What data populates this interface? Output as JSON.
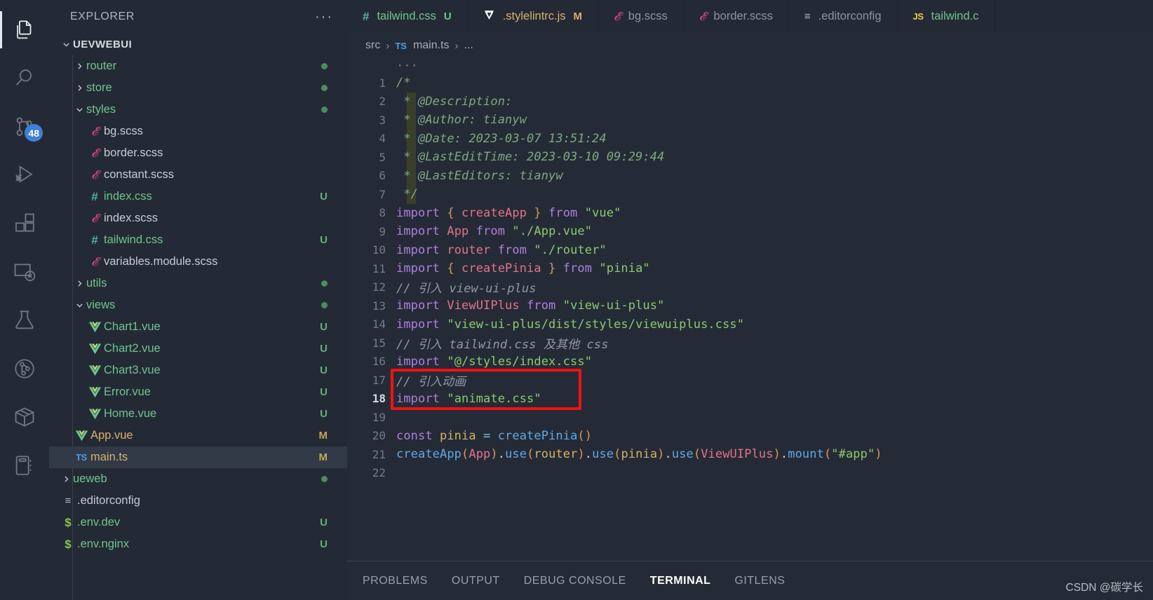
{
  "activity_bar": {
    "items": [
      {
        "name": "explorer",
        "icon": "files-icon",
        "active": true
      },
      {
        "name": "search",
        "icon": "search-icon",
        "active": false
      },
      {
        "name": "source-control",
        "icon": "source-control-icon",
        "active": false,
        "badge": "48"
      },
      {
        "name": "run-and-debug",
        "icon": "run-debug-icon",
        "active": false
      },
      {
        "name": "extensions",
        "icon": "extensions-icon",
        "active": false
      },
      {
        "name": "remote-explorer",
        "icon": "remote-explorer-icon",
        "active": false
      },
      {
        "name": "testing",
        "icon": "flask-icon",
        "active": false
      },
      {
        "name": "gitlens",
        "icon": "gitlens-icon",
        "active": false
      },
      {
        "name": "package",
        "icon": "package-icon",
        "active": false
      },
      {
        "name": "notebook",
        "icon": "notebook-icon",
        "active": false
      }
    ]
  },
  "sidebar": {
    "title": "EXPLORER",
    "more_actions": "···",
    "root_folder": "UEVWEBUI",
    "tree": [
      {
        "label": "router",
        "type": "folder",
        "indent": 1,
        "expanded": false,
        "color": "green",
        "status": "dot",
        "icon": "folder-icon"
      },
      {
        "label": "store",
        "type": "folder",
        "indent": 1,
        "expanded": false,
        "color": "green",
        "status": "dot",
        "icon": "folder-icon"
      },
      {
        "label": "styles",
        "type": "folder",
        "indent": 1,
        "expanded": true,
        "color": "green",
        "status": "dot",
        "icon": "folder-icon"
      },
      {
        "label": "bg.scss",
        "type": "file",
        "indent": 2,
        "color": "gray",
        "status": "",
        "icon": "scss-icon"
      },
      {
        "label": "border.scss",
        "type": "file",
        "indent": 2,
        "color": "gray",
        "status": "",
        "icon": "scss-icon"
      },
      {
        "label": "constant.scss",
        "type": "file",
        "indent": 2,
        "color": "gray",
        "status": "",
        "icon": "scss-icon"
      },
      {
        "label": "index.css",
        "type": "file",
        "indent": 2,
        "color": "green",
        "status": "U",
        "icon": "css-icon"
      },
      {
        "label": "index.scss",
        "type": "file",
        "indent": 2,
        "color": "gray",
        "status": "",
        "icon": "scss-icon"
      },
      {
        "label": "tailwind.css",
        "type": "file",
        "indent": 2,
        "color": "green",
        "status": "U",
        "icon": "css-icon"
      },
      {
        "label": "variables.module.scss",
        "type": "file",
        "indent": 2,
        "color": "gray",
        "status": "",
        "icon": "scss-icon"
      },
      {
        "label": "utils",
        "type": "folder",
        "indent": 1,
        "expanded": false,
        "color": "green",
        "status": "dot",
        "icon": "folder-icon"
      },
      {
        "label": "views",
        "type": "folder",
        "indent": 1,
        "expanded": true,
        "color": "green",
        "status": "dot",
        "icon": "folder-icon"
      },
      {
        "label": "Chart1.vue",
        "type": "file",
        "indent": 2,
        "color": "green",
        "status": "U",
        "icon": "vue-icon"
      },
      {
        "label": "Chart2.vue",
        "type": "file",
        "indent": 2,
        "color": "green",
        "status": "U",
        "icon": "vue-icon"
      },
      {
        "label": "Chart3.vue",
        "type": "file",
        "indent": 2,
        "color": "green",
        "status": "U",
        "icon": "vue-icon"
      },
      {
        "label": "Error.vue",
        "type": "file",
        "indent": 2,
        "color": "green",
        "status": "U",
        "icon": "vue-icon"
      },
      {
        "label": "Home.vue",
        "type": "file",
        "indent": 2,
        "color": "green",
        "status": "U",
        "icon": "vue-icon"
      },
      {
        "label": "App.vue",
        "type": "file",
        "indent": 1,
        "color": "orange",
        "status": "M",
        "icon": "vue-icon"
      },
      {
        "label": "main.ts",
        "type": "file",
        "indent": 1,
        "color": "orange",
        "status": "M",
        "icon": "ts-icon",
        "selected": true
      },
      {
        "label": "ueweb",
        "type": "folder",
        "indent": 0,
        "expanded": false,
        "color": "green",
        "status": "dot",
        "icon": "folder-icon"
      },
      {
        "label": ".editorconfig",
        "type": "file",
        "indent": 0,
        "color": "gray",
        "status": "",
        "icon": "editorconfig-icon"
      },
      {
        "label": ".env.dev",
        "type": "file",
        "indent": 0,
        "color": "green",
        "status": "U",
        "icon": "env-icon"
      },
      {
        "label": ".env.nginx",
        "type": "file",
        "indent": 0,
        "color": "green",
        "status": "U",
        "icon": "env-icon"
      }
    ]
  },
  "tabs": [
    {
      "label": "tailwind.css",
      "status": "U",
      "state": "u",
      "icon": "css-icon",
      "active": false
    },
    {
      "label": ".stylelintrc.js",
      "status": "M",
      "state": "m",
      "icon": "stylelint-icon",
      "active": false
    },
    {
      "label": "bg.scss",
      "status": "",
      "state": "none",
      "icon": "scss-icon",
      "active": false
    },
    {
      "label": "border.scss",
      "status": "",
      "state": "none",
      "icon": "scss-icon",
      "active": false
    },
    {
      "label": ".editorconfig",
      "status": "",
      "state": "none",
      "icon": "editorconfig-icon",
      "active": false
    },
    {
      "label": "tailwind.c",
      "status": "",
      "state": "u",
      "icon": "js-icon",
      "active": false
    }
  ],
  "breadcrumb": {
    "root": "src",
    "sep": "›",
    "file_icon": "TS",
    "file": "main.ts",
    "tail": "..."
  },
  "editor": {
    "overflow_indicator": "···",
    "current_line": 18,
    "lines": [
      {
        "n": 1,
        "tokens": [
          {
            "t": "/*",
            "c": "cm"
          }
        ]
      },
      {
        "n": 2,
        "tokens": [
          {
            "t": " * @Description: ",
            "c": "cm"
          }
        ]
      },
      {
        "n": 3,
        "tokens": [
          {
            "t": " * @Author: tianyw",
            "c": "cm"
          }
        ]
      },
      {
        "n": 4,
        "tokens": [
          {
            "t": " * @Date: 2023-03-07 13:51:24",
            "c": "cm"
          }
        ]
      },
      {
        "n": 5,
        "tokens": [
          {
            "t": " * @LastEditTime: 2023-03-10 09:29:44",
            "c": "cm"
          }
        ]
      },
      {
        "n": 6,
        "tokens": [
          {
            "t": " * @LastEditors: tianyw",
            "c": "cm"
          }
        ]
      },
      {
        "n": 7,
        "tokens": [
          {
            "t": " */",
            "c": "cm"
          }
        ]
      },
      {
        "n": 8,
        "tokens": [
          {
            "t": "import ",
            "c": "kw"
          },
          {
            "t": "{ ",
            "c": "br"
          },
          {
            "t": "createApp",
            "c": "id"
          },
          {
            "t": " }",
            "c": "br"
          },
          {
            "t": " from ",
            "c": "kw"
          },
          {
            "t": "\"vue\"",
            "c": "str"
          }
        ]
      },
      {
        "n": 9,
        "tokens": [
          {
            "t": "import ",
            "c": "kw"
          },
          {
            "t": "App",
            "c": "id"
          },
          {
            "t": " from ",
            "c": "kw"
          },
          {
            "t": "\"./App.vue\"",
            "c": "str"
          }
        ]
      },
      {
        "n": 10,
        "tokens": [
          {
            "t": "import ",
            "c": "kw"
          },
          {
            "t": "router",
            "c": "id"
          },
          {
            "t": " from ",
            "c": "kw"
          },
          {
            "t": "\"./router\"",
            "c": "str"
          }
        ]
      },
      {
        "n": 11,
        "tokens": [
          {
            "t": "import ",
            "c": "kw"
          },
          {
            "t": "{ ",
            "c": "br"
          },
          {
            "t": "createPinia",
            "c": "id"
          },
          {
            "t": " }",
            "c": "br"
          },
          {
            "t": " from ",
            "c": "kw"
          },
          {
            "t": "\"pinia\"",
            "c": "str"
          }
        ]
      },
      {
        "n": 12,
        "tokens": [
          {
            "t": "// 引入 view-ui-plus",
            "c": "cmg"
          }
        ]
      },
      {
        "n": 13,
        "tokens": [
          {
            "t": "import ",
            "c": "kw"
          },
          {
            "t": "ViewUIPlus",
            "c": "id"
          },
          {
            "t": " from ",
            "c": "kw"
          },
          {
            "t": "\"view-ui-plus\"",
            "c": "str"
          }
        ]
      },
      {
        "n": 14,
        "tokens": [
          {
            "t": "import ",
            "c": "kw"
          },
          {
            "t": "\"view-ui-plus/dist/styles/viewuiplus.css\"",
            "c": "str"
          }
        ]
      },
      {
        "n": 15,
        "tokens": [
          {
            "t": "// 引入 tailwind.css 及其他 css",
            "c": "cmg"
          }
        ]
      },
      {
        "n": 16,
        "tokens": [
          {
            "t": "import ",
            "c": "kw"
          },
          {
            "t": "\"@/styles/index.css\"",
            "c": "str"
          }
        ]
      },
      {
        "n": 17,
        "tokens": [
          {
            "t": "// 引入动画",
            "c": "cmg"
          }
        ]
      },
      {
        "n": 18,
        "tokens": [
          {
            "t": "import ",
            "c": "kw"
          },
          {
            "t": "\"animate.css\"",
            "c": "str"
          }
        ]
      },
      {
        "n": 19,
        "tokens": []
      },
      {
        "n": 20,
        "tokens": [
          {
            "t": "const ",
            "c": "kw"
          },
          {
            "t": "pinia",
            "c": "vr"
          },
          {
            "t": " = ",
            "c": "op"
          },
          {
            "t": "createPinia",
            "c": "fn"
          },
          {
            "t": "()",
            "c": "br"
          }
        ]
      },
      {
        "n": 21,
        "tokens": [
          {
            "t": "createApp",
            "c": "fn"
          },
          {
            "t": "(",
            "c": "br"
          },
          {
            "t": "App",
            "c": "id"
          },
          {
            "t": ")",
            "c": "br"
          },
          {
            "t": ".",
            "c": "pn"
          },
          {
            "t": "use",
            "c": "fn"
          },
          {
            "t": "(",
            "c": "br"
          },
          {
            "t": "router",
            "c": "vr"
          },
          {
            "t": ")",
            "c": "br"
          },
          {
            "t": ".",
            "c": "pn"
          },
          {
            "t": "use",
            "c": "fn"
          },
          {
            "t": "(",
            "c": "br"
          },
          {
            "t": "pinia",
            "c": "vr"
          },
          {
            "t": ")",
            "c": "br"
          },
          {
            "t": ".",
            "c": "pn"
          },
          {
            "t": "use",
            "c": "fn"
          },
          {
            "t": "(",
            "c": "br"
          },
          {
            "t": "ViewUIPlus",
            "c": "id"
          },
          {
            "t": ")",
            "c": "br"
          },
          {
            "t": ".",
            "c": "pn"
          },
          {
            "t": "mount",
            "c": "fn"
          },
          {
            "t": "(",
            "c": "br"
          },
          {
            "t": "\"#app\"",
            "c": "str"
          },
          {
            "t": ")",
            "c": "br"
          }
        ]
      },
      {
        "n": 22,
        "tokens": []
      }
    ],
    "annotation_box": {
      "color": "#f51111",
      "covers_lines": [
        17,
        18
      ]
    }
  },
  "panel": {
    "tabs": [
      {
        "label": "PROBLEMS",
        "active": false
      },
      {
        "label": "OUTPUT",
        "active": false
      },
      {
        "label": "DEBUG CONSOLE",
        "active": false
      },
      {
        "label": "TERMINAL",
        "active": true
      },
      {
        "label": "GITLENS",
        "active": false
      }
    ]
  },
  "watermark": "CSDN @碳学长"
}
